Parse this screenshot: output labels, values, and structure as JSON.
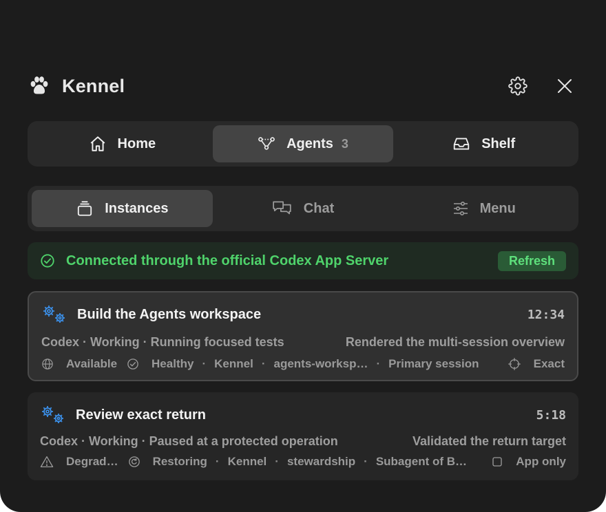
{
  "app": {
    "title": "Kennel"
  },
  "main_tabs": [
    {
      "label": "Home",
      "icon": "home-icon"
    },
    {
      "label": "Agents",
      "count": "3",
      "icon": "agents-graph-icon",
      "active": true
    },
    {
      "label": "Shelf",
      "icon": "inbox-tray-icon"
    }
  ],
  "sub_tabs": [
    {
      "label": "Instances",
      "icon": "stack-icon",
      "active": true
    },
    {
      "label": "Chat",
      "icon": "chat-bubbles-icon"
    },
    {
      "label": "Menu",
      "icon": "sliders-icon"
    }
  ],
  "banner": {
    "text": "Connected through the official Codex App Server",
    "button": "Refresh",
    "color": "#4fd36b"
  },
  "tasks": [
    {
      "title": "Build the Agents workspace",
      "time": "12:34",
      "status_left": "Codex · Working · Running focused tests",
      "status_right": "Rendered the multi-session overview",
      "availability": "Available",
      "health": "Healthy",
      "project": "Kennel",
      "branch": "agents-worksp…",
      "session": "Primary session",
      "mode": "Exact",
      "selected": true
    },
    {
      "title": "Review exact return",
      "time": "5:18",
      "status_left": "Codex · Working · Paused at a protected operation",
      "status_right": "Validated the return target",
      "availability": "Degrad…",
      "health": "Restoring",
      "project": "Kennel",
      "branch": "stewardship",
      "session": "Subagent of B…",
      "mode": "App only",
      "selected": false
    }
  ],
  "separator": "·",
  "colors": {
    "background": "#1c1c1c",
    "accent_blue": "#3b8fe8",
    "success_green": "#4fd36b"
  }
}
